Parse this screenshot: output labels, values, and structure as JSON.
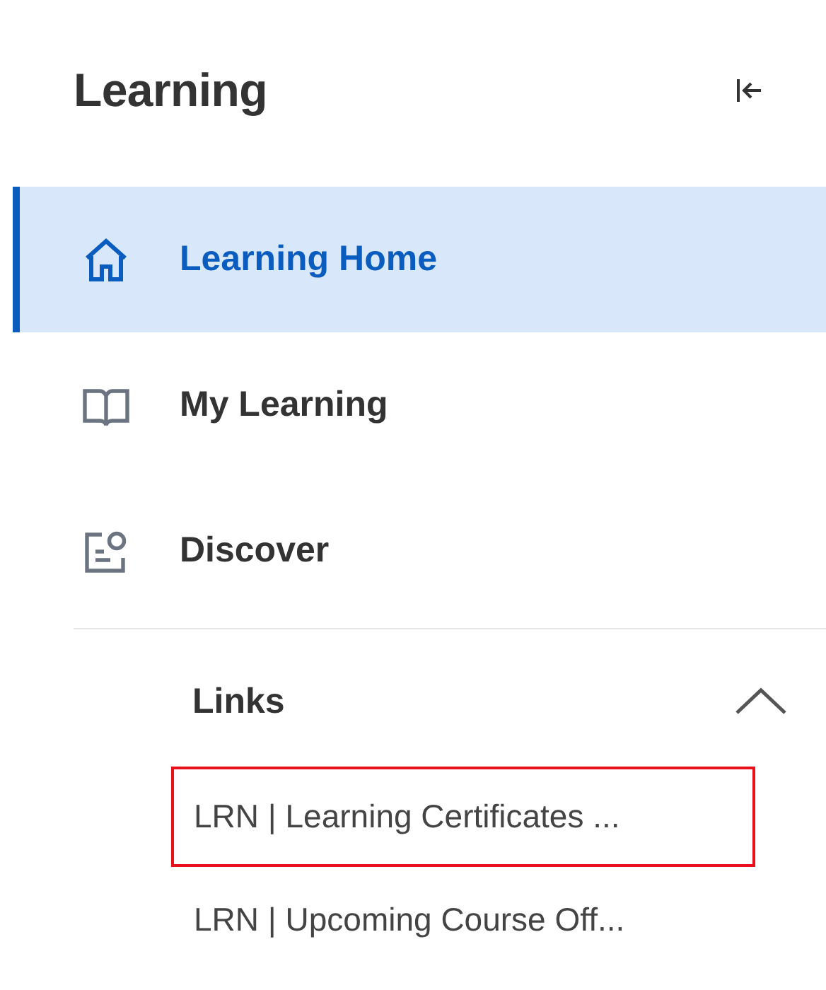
{
  "title": "Learning",
  "nav_items": [
    {
      "label": "Learning Home",
      "kind": "home",
      "selected": true
    },
    {
      "label": "My Learning",
      "kind": "book",
      "selected": false
    },
    {
      "label": "Discover",
      "kind": "discover",
      "selected": false
    }
  ],
  "links_section": {
    "title": "Links",
    "expanded": true,
    "links": [
      {
        "label": "LRN | Learning Certificates ...",
        "highlighted": true
      },
      {
        "label": "LRN | Upcoming Course Off...",
        "highlighted": false
      }
    ]
  }
}
